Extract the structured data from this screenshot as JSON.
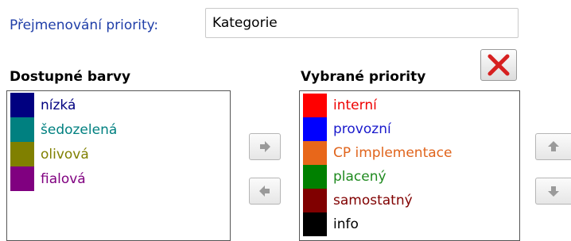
{
  "rename": {
    "label": "Přejmenování priority:",
    "value": "Kategorie"
  },
  "available": {
    "heading": "Dostupné barvy",
    "items": [
      {
        "label": "nízká",
        "color": "#000080"
      },
      {
        "label": "šedozelená",
        "color": "#008080"
      },
      {
        "label": "olivová",
        "color": "#808000"
      },
      {
        "label": "fialová",
        "color": "#800080"
      }
    ]
  },
  "selected": {
    "heading": "Vybrané priority",
    "items": [
      {
        "label": "interní",
        "color": "#ff0000",
        "text_color": "#ee0000"
      },
      {
        "label": "provozní",
        "color": "#0000ff",
        "text_color": "#1a1acc"
      },
      {
        "label": "CP implementace",
        "color": "#e8671a",
        "text_color": "#e0641c"
      },
      {
        "label": "placený",
        "color": "#008000",
        "text_color": "#1f8a1f"
      },
      {
        "label": "samostatný",
        "color": "#800000",
        "text_color": "#800000"
      },
      {
        "label": "info",
        "color": "#000000",
        "text_color": "#000000"
      }
    ]
  },
  "buttons": {
    "add_icon": "arrow-right-icon",
    "remove_icon": "arrow-left-icon",
    "up_icon": "arrow-up-icon",
    "down_icon": "arrow-down-icon",
    "delete_icon": "red-x-icon"
  },
  "colors": {
    "label_blue": "#1f3ea8",
    "delete_red": "#d62020"
  }
}
